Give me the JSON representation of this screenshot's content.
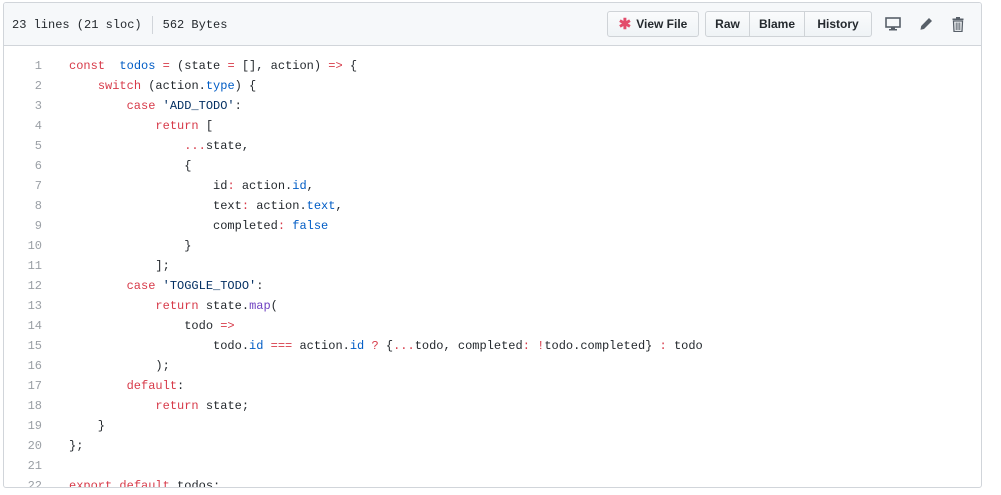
{
  "file_info": {
    "lines": "23 lines (21 sloc)",
    "size": "562 Bytes"
  },
  "toolbar": {
    "view_file_label": "View File",
    "raw_label": "Raw",
    "blame_label": "Blame",
    "history_label": "History",
    "icons": [
      "desktop-icon",
      "pencil-icon",
      "trash-icon"
    ]
  },
  "code_lines": [
    {
      "n": "1",
      "tokens": [
        [
          "k",
          "const"
        ],
        [
          "",
          "  "
        ],
        [
          "c",
          "todos"
        ],
        [
          "",
          " "
        ],
        [
          "k",
          "="
        ],
        [
          "",
          " (state "
        ],
        [
          "k",
          "="
        ],
        [
          "",
          " [], action) "
        ],
        [
          "k",
          "=>"
        ],
        [
          "",
          " {"
        ]
      ]
    },
    {
      "n": "2",
      "tokens": [
        [
          "",
          "    "
        ],
        [
          "k",
          "switch"
        ],
        [
          "",
          " (action."
        ],
        [
          "c",
          "type"
        ],
        [
          "",
          ") {"
        ]
      ]
    },
    {
      "n": "3",
      "tokens": [
        [
          "",
          "        "
        ],
        [
          "k",
          "case"
        ],
        [
          "",
          " "
        ],
        [
          "s",
          "'ADD_TODO'"
        ],
        [
          "",
          ":"
        ]
      ]
    },
    {
      "n": "4",
      "tokens": [
        [
          "",
          "            "
        ],
        [
          "k",
          "return"
        ],
        [
          "",
          " ["
        ]
      ]
    },
    {
      "n": "5",
      "tokens": [
        [
          "",
          "                "
        ],
        [
          "k",
          "..."
        ],
        [
          "",
          "state,"
        ]
      ]
    },
    {
      "n": "6",
      "tokens": [
        [
          "",
          "                {"
        ]
      ]
    },
    {
      "n": "7",
      "tokens": [
        [
          "",
          "                    id"
        ],
        [
          "k",
          ":"
        ],
        [
          "",
          " action."
        ],
        [
          "c",
          "id"
        ],
        [
          "",
          ","
        ]
      ]
    },
    {
      "n": "8",
      "tokens": [
        [
          "",
          "                    text"
        ],
        [
          "k",
          ":"
        ],
        [
          "",
          " action."
        ],
        [
          "c",
          "text"
        ],
        [
          "",
          ","
        ]
      ]
    },
    {
      "n": "9",
      "tokens": [
        [
          "",
          "                    completed"
        ],
        [
          "k",
          ":"
        ],
        [
          "",
          " "
        ],
        [
          "c",
          "false"
        ]
      ]
    },
    {
      "n": "10",
      "tokens": [
        [
          "",
          "                }"
        ]
      ]
    },
    {
      "n": "11",
      "tokens": [
        [
          "",
          "            ];"
        ]
      ]
    },
    {
      "n": "12",
      "tokens": [
        [
          "",
          "        "
        ],
        [
          "k",
          "case"
        ],
        [
          "",
          " "
        ],
        [
          "s",
          "'TOGGLE_TODO'"
        ],
        [
          "",
          ":"
        ]
      ]
    },
    {
      "n": "13",
      "tokens": [
        [
          "",
          "            "
        ],
        [
          "k",
          "return"
        ],
        [
          "",
          " state."
        ],
        [
          "f",
          "map"
        ],
        [
          "",
          "("
        ]
      ]
    },
    {
      "n": "14",
      "tokens": [
        [
          "",
          "                todo "
        ],
        [
          "k",
          "=>"
        ]
      ]
    },
    {
      "n": "15",
      "tokens": [
        [
          "",
          "                    todo."
        ],
        [
          "c",
          "id"
        ],
        [
          "",
          " "
        ],
        [
          "k",
          "==="
        ],
        [
          "",
          " action."
        ],
        [
          "c",
          "id"
        ],
        [
          "",
          " "
        ],
        [
          "k",
          "?"
        ],
        [
          "",
          " {"
        ],
        [
          "k",
          "..."
        ],
        [
          "",
          "todo, completed"
        ],
        [
          "k",
          ":"
        ],
        [
          "",
          " "
        ],
        [
          "k",
          "!"
        ],
        [
          "",
          "todo.completed} "
        ],
        [
          "k",
          ":"
        ],
        [
          "",
          " todo"
        ]
      ]
    },
    {
      "n": "16",
      "tokens": [
        [
          "",
          "            );"
        ]
      ]
    },
    {
      "n": "17",
      "tokens": [
        [
          "",
          "        "
        ],
        [
          "k",
          "default"
        ],
        [
          "",
          ":"
        ]
      ]
    },
    {
      "n": "18",
      "tokens": [
        [
          "",
          "            "
        ],
        [
          "k",
          "return"
        ],
        [
          "",
          " state;"
        ]
      ]
    },
    {
      "n": "19",
      "tokens": [
        [
          "",
          "    }"
        ]
      ]
    },
    {
      "n": "20",
      "tokens": [
        [
          "",
          "};"
        ]
      ]
    },
    {
      "n": "21",
      "tokens": []
    },
    {
      "n": "22",
      "tokens": [
        [
          "k",
          "export"
        ],
        [
          "",
          " "
        ],
        [
          "k",
          "default"
        ],
        [
          "",
          " todos;"
        ]
      ]
    }
  ]
}
